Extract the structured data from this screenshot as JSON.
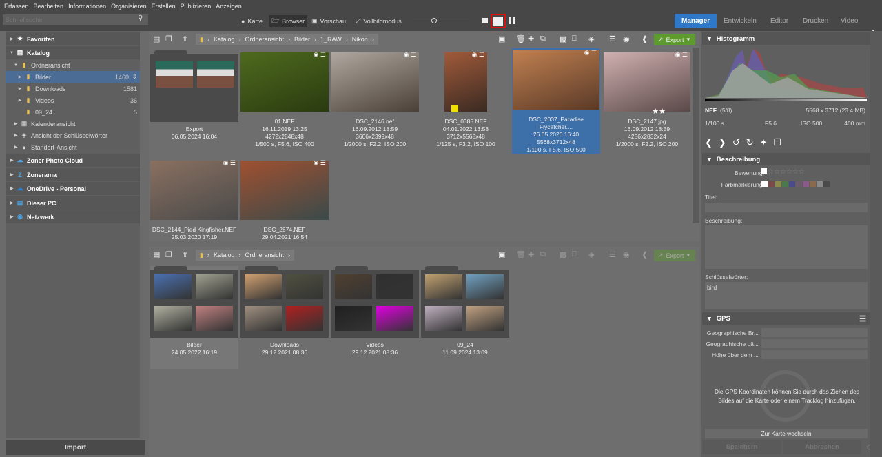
{
  "menu": [
    "Erfassen",
    "Bearbeiten",
    "Informationen",
    "Organisieren",
    "Erstellen",
    "Publizieren",
    "Anzeigen"
  ],
  "search": {
    "placeholder": "Schnellsuche",
    "icon": "search-icon"
  },
  "views": [
    {
      "label": "Karte",
      "icon": "map-pin-icon"
    },
    {
      "label": "Browser",
      "icon": "browser-folder-icon",
      "active": true
    },
    {
      "label": "Vorschau",
      "icon": "preview-image-icon"
    },
    {
      "label": "Vollbildmodus",
      "icon": "fullscreen-icon"
    }
  ],
  "modules": [
    {
      "label": "Manager",
      "active": true
    },
    {
      "label": "Entwickeln"
    },
    {
      "label": "Editor"
    },
    {
      "label": "Drucken"
    },
    {
      "label": "Video"
    }
  ],
  "accent": "#2f78c8",
  "sidebar": {
    "items": [
      {
        "label": "Favoriten",
        "icon": "star-icon",
        "bold": true,
        "level": 0
      },
      {
        "label": "Katalog",
        "icon": "catalog-icon",
        "bold": true,
        "level": 0,
        "open": true
      },
      {
        "label": "Ordneransicht",
        "icon": "folder-icon",
        "level": 1,
        "open": true
      },
      {
        "label": "Bilder",
        "icon": "folder-icon",
        "level": 2,
        "count": "1460",
        "selected": true
      },
      {
        "label": "Downloads",
        "icon": "folder-icon",
        "level": 2,
        "count": "1581"
      },
      {
        "label": "Videos",
        "icon": "folder-icon",
        "level": 2,
        "count": "36"
      },
      {
        "label": "09_24",
        "icon": "folder-icon",
        "level": 2,
        "count": "5",
        "noarrow": true
      },
      {
        "label": "Kalenderansicht",
        "icon": "calendar-icon",
        "level": 1
      },
      {
        "label": "Ansicht der Schlüsselwörter",
        "icon": "tag-icon",
        "level": 1
      },
      {
        "label": "Standort-Ansicht",
        "icon": "location-icon",
        "level": 1
      },
      {
        "label": "Zoner Photo Cloud",
        "icon": "cloud-icon",
        "bold": true,
        "level": 0
      },
      {
        "label": "Zonerama",
        "icon": "zonerama-icon",
        "bold": true,
        "level": 0
      },
      {
        "label": "OneDrive - Personal",
        "icon": "onedrive-icon",
        "bold": true,
        "level": 0
      },
      {
        "label": "Dieser PC",
        "icon": "computer-icon",
        "bold": true,
        "level": 0
      },
      {
        "label": "Netzwerk",
        "icon": "network-icon",
        "bold": true,
        "level": 0
      }
    ],
    "import_label": "Import"
  },
  "top_pane": {
    "breadcrumb": [
      "Katalog",
      "Ordneransicht",
      "Bilder",
      "1_RAW",
      "Nikon"
    ],
    "export_label": "Export",
    "items": [
      {
        "type": "folder",
        "name": "Export",
        "lines": [
          "06.05.2024 16:04"
        ],
        "colors": [
          "#7a5040",
          "#7a5040"
        ]
      },
      {
        "name": "01.NEF",
        "lines": [
          "16.11.2019 13:25",
          "4272x2848x48",
          "1/500 s, F5.6, ISO 400"
        ],
        "colors": [
          "#4e6a1e",
          "#2a3a10"
        ],
        "w": 128
      },
      {
        "name": "DSC_2146.nef",
        "lines": [
          "16.09.2012 18:59",
          "3606x2399x48",
          "1/2000 s, F2.2, ISO 200"
        ],
        "colors": [
          "#b0a8a0",
          "#4a4038"
        ],
        "w": 128
      },
      {
        "name": "DSC_0385.NEF",
        "lines": [
          "04.01.2022 13:58",
          "3712x5568x48",
          "1/125 s, F3.2, ISO 100"
        ],
        "colors": [
          "#a05a3a",
          "#3a2a22"
        ],
        "w": 62,
        "colorlabel": "#f0e000"
      },
      {
        "name": "DSC_2037_Paradise Flycatcher....",
        "lines": [
          "26.05.2020 16:40",
          "5568x3712x48",
          "1/100 s, F5.6, ISO 500"
        ],
        "colors": [
          "#c08050",
          "#5a3a28"
        ],
        "w": 126,
        "selected": true
      },
      {
        "name": "DSC_2147.jpg",
        "lines": [
          "16.09.2012 18:59",
          "4256x2832x24",
          "1/2000 s, F2.2, ISO 200"
        ],
        "colors": [
          "#d0b0b0",
          "#5a4848"
        ],
        "w": 126,
        "rating": 2
      },
      {
        "name": "DSC_2144_Pied Kingfisher.NEF",
        "lines": [
          "25.03.2020 17:19"
        ],
        "colors": [
          "#8a7060",
          "#4a4a4a"
        ],
        "w": 128
      },
      {
        "name": "DSC_2674.NEF",
        "lines": [
          "29.04.2021 16:54"
        ],
        "colors": [
          "#a05030",
          "#3a4a4a"
        ],
        "w": 128
      }
    ]
  },
  "bottom_pane": {
    "breadcrumb": [
      "Katalog",
      "Ordneransicht"
    ],
    "export_label": "Export",
    "items": [
      {
        "name": "Bilder",
        "lines": [
          "24.05.2022 16:19"
        ],
        "selected": true,
        "minis": [
          "#4a70b0",
          "#a0a090",
          "#b0b0a0",
          "#c08080"
        ]
      },
      {
        "name": "Downloads",
        "lines": [
          "29.12.2021 08:36"
        ],
        "minis": [
          "#d0a070",
          "#505040",
          "#a09080",
          "#b02020"
        ]
      },
      {
        "name": "Videos",
        "lines": [
          "29.12.2021 08:36"
        ],
        "minis": [
          "#504030",
          "#303030",
          "#202020",
          "#e000e0"
        ]
      },
      {
        "name": "09_24",
        "lines": [
          "11.09.2024 13:09"
        ],
        "minis": [
          "#c0a070",
          "#70a0c0",
          "#c0b0c0",
          "#c0a080"
        ]
      }
    ]
  },
  "right": {
    "histogram_title": "Histogramm",
    "format": "NEF",
    "position": "(5/8)",
    "dimensions": "5568 x 3712 (23.4 MB)",
    "shutter": "1/100 s",
    "aperture": "F5.6",
    "iso": "ISO 500",
    "focal": "400 mm",
    "desc_title": "Beschreibung",
    "rating_label": "Bewertung:",
    "rating": 0,
    "color_label": "Farbmarkierung:",
    "color_swatches": [
      "#7a4a4a",
      "#8a8a4a",
      "#4a7a4a",
      "#4a4a8a",
      "#6a5a6a",
      "#8a5a8a",
      "#8a6a4a",
      "#8a8a8a",
      "#4a4a4a"
    ],
    "title_label": "Titel:",
    "title_value": "",
    "description_label": "Beschreibung:",
    "description_value": "",
    "keywords_label": "Schlüsselwörter:",
    "keywords_value": "bird",
    "gps_title": "GPS",
    "gps_fields": [
      "Geographische Br...",
      "Geographische Lä...",
      "Höhe über dem ..."
    ],
    "gps_note": "Die GPS Koordinaten können Sie durch das Ziehen des Bildes auf die Karte oder einem Tracklog hinzufügen.",
    "map_button": "Zur Karte wechseln",
    "save": "Speichern",
    "cancel": "Abbrechen"
  }
}
